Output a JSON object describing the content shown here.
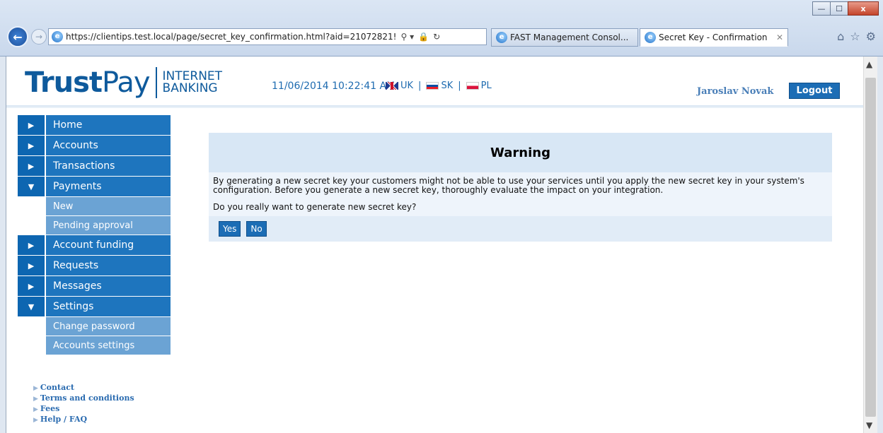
{
  "browser": {
    "url": "https://clientips.test.local/page/secret_key_confirmation.html?aid=21072821!",
    "tabs": [
      {
        "label": "FAST Management Consol..."
      },
      {
        "label": "Secret Key - Confirmation"
      }
    ],
    "window_buttons": {
      "minimize": "—",
      "maximize": "☐",
      "close": "x"
    }
  },
  "header": {
    "logo_trust": "Trust",
    "logo_pay": "Pay",
    "logo_sub_line1": "INTERNET",
    "logo_sub_line2": "BANKING",
    "datetime": "11/06/2014 10:22:41 AM",
    "languages": [
      {
        "label": "UK"
      },
      {
        "label": "SK"
      },
      {
        "label": "PL"
      }
    ],
    "user_name": "Jaroslav Novak",
    "logout_label": "Logout"
  },
  "sidebar": {
    "items": [
      {
        "label": "Home",
        "expanded": false
      },
      {
        "label": "Accounts",
        "expanded": false
      },
      {
        "label": "Transactions",
        "expanded": false
      },
      {
        "label": "Payments",
        "expanded": true,
        "sub": [
          {
            "label": "New"
          },
          {
            "label": "Pending approval"
          }
        ]
      },
      {
        "label": "Account funding",
        "expanded": false
      },
      {
        "label": "Requests",
        "expanded": false
      },
      {
        "label": "Messages",
        "expanded": false
      },
      {
        "label": "Settings",
        "expanded": true,
        "sub": [
          {
            "label": "Change password"
          },
          {
            "label": "Accounts settings"
          }
        ]
      }
    ],
    "footer_links": [
      {
        "label": "Contact"
      },
      {
        "label": "Terms and conditions"
      },
      {
        "label": "Fees"
      },
      {
        "label": "Help / FAQ"
      }
    ]
  },
  "warning": {
    "title": "Warning",
    "body": "By generating a new secret key your customers might not be able to use your services until you apply the new secret key in your system's configuration. Before you generate a new secret key, thoroughly evaluate the impact on your integration.",
    "question": "Do you really want to generate new secret key?",
    "yes_label": "Yes",
    "no_label": "No"
  },
  "colors": {
    "brand": "#0e5a9c",
    "sidebar_item": "#1e75be",
    "sidebar_sub": "#6ba3d4",
    "button": "#1c6db5"
  }
}
